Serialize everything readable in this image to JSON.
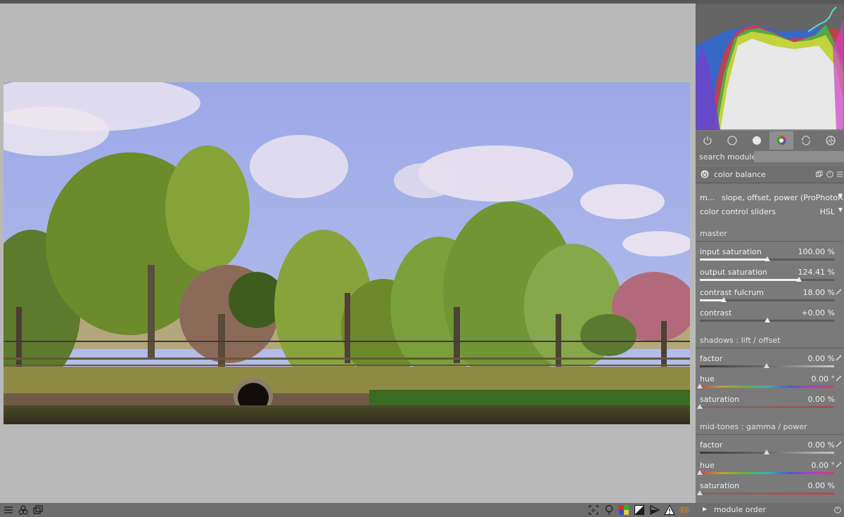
{
  "bottom_toolbar": {
    "left_icons": [
      "list-icon",
      "tags-icon",
      "windows-icon"
    ],
    "right_icons": [
      "focus-peaking-icon",
      "lightbulb-icon",
      "color-assessment-icon",
      "overexposed-icon",
      "softproof-icon",
      "gamut-check-icon",
      "guides-icon"
    ]
  },
  "module_tabs": [
    "power-icon",
    "circle-icon",
    "circle-fill-icon",
    "color-wheel-icon",
    "refresh-circle-icon",
    "aperture-icon"
  ],
  "search": {
    "label": "search module",
    "placeholder": ""
  },
  "module": {
    "title": "color balance",
    "mode_label": "m...",
    "mode_value": "slope, offset, power (ProPhotoR...",
    "control_label": "color control sliders",
    "control_value": "HSL",
    "master_title": "master",
    "master": [
      {
        "label": "input saturation",
        "value": "100.00 %",
        "level": 0.5
      },
      {
        "label": "output saturation",
        "value": "124.41 %",
        "level": 0.74
      },
      {
        "label": "contrast fulcrum",
        "value": "18.00 %",
        "level": 0.18
      },
      {
        "label": "contrast",
        "value": "+0.00 %",
        "level": 0.5
      }
    ],
    "shadows_title": "shadows : lift / offset",
    "shadows": [
      {
        "label": "factor",
        "value": "0.00 %"
      },
      {
        "label": "hue",
        "value": "0.00 °"
      },
      {
        "label": "saturation",
        "value": "0.00 %"
      }
    ],
    "midtones_title": "mid-tones : gamma / power",
    "midtones": [
      {
        "label": "factor",
        "value": "0.00 %"
      },
      {
        "label": "hue",
        "value": "0.00 °"
      },
      {
        "label": "saturation",
        "value": "0.00 %"
      }
    ]
  },
  "module_order_label": "module order"
}
